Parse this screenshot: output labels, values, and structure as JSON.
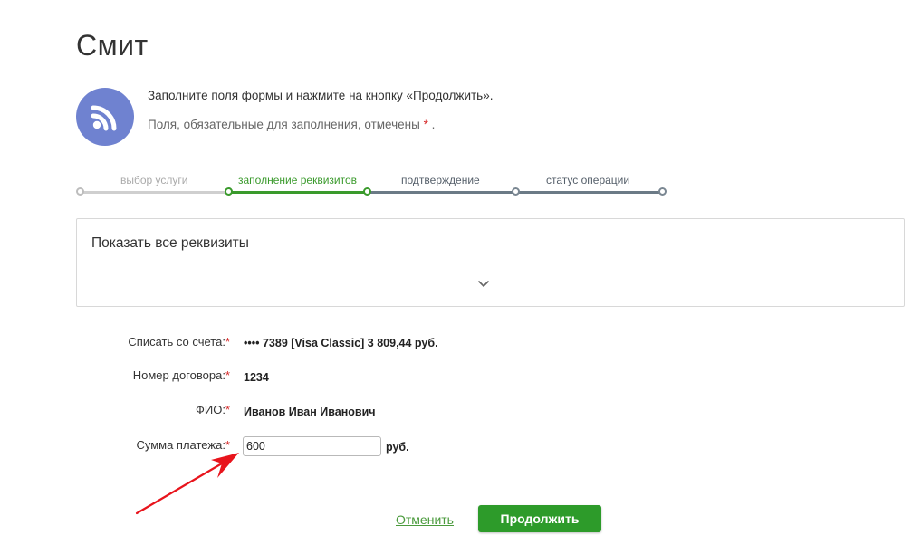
{
  "page": {
    "title": "Смит",
    "instruction": "Заполните поля формы и нажмите на кнопку «Продолжить».",
    "required_note_prefix": "Поля, обязательные для заполнения, отмечены ",
    "required_note_star": "*",
    "required_note_suffix": " ."
  },
  "provider_icon": {
    "name": "rss-feed-icon",
    "color": "#6f82d0"
  },
  "steps": [
    {
      "label": "выбор услуги",
      "state": "done"
    },
    {
      "label": "заполнение реквизитов",
      "state": "active"
    },
    {
      "label": "подтверждение",
      "state": "future"
    },
    {
      "label": "статус операции",
      "state": "future"
    }
  ],
  "details_panel": {
    "title": "Показать все реквизиты",
    "icon": "chevron-down-icon"
  },
  "form": {
    "required_mark": "*",
    "account": {
      "label": "Списать со счета:",
      "value": "•••• 7389  [Visa Classic] 3 809,44   руб."
    },
    "contract": {
      "label": "Номер договора:",
      "value": "1234"
    },
    "fio": {
      "label": "ФИО:",
      "value": "Иванов Иван Иванович"
    },
    "amount": {
      "label": "Сумма платежа:",
      "value": "600",
      "currency": "руб."
    }
  },
  "actions": {
    "cancel_label": "Отменить",
    "continue_label": "Продолжить"
  },
  "colors": {
    "accent_green": "#2d9b2a",
    "required_red": "#d62828",
    "annotation_arrow": "#e8141c"
  }
}
